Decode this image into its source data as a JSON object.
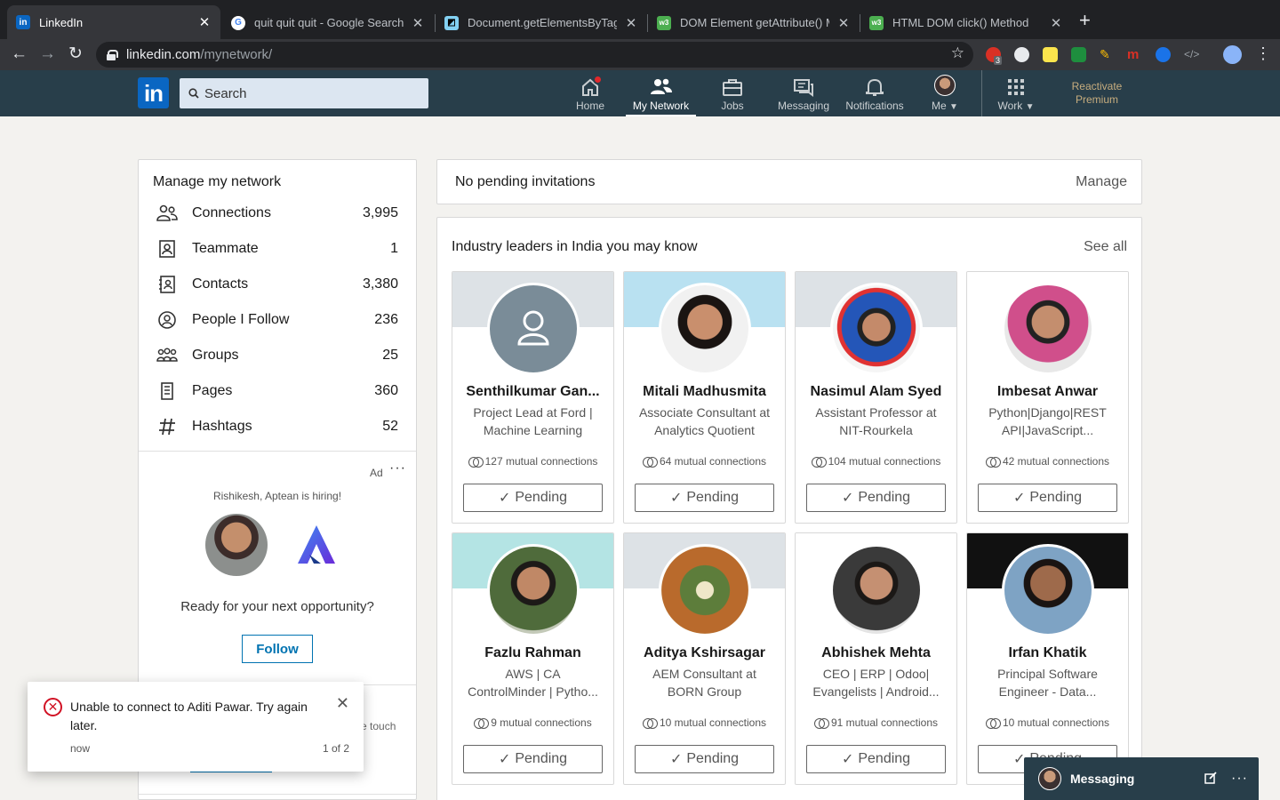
{
  "browser": {
    "tabs": [
      {
        "title": "LinkedIn",
        "favicon": "linkedin-icon",
        "active": true
      },
      {
        "title": "quit quit quit - Google Search",
        "favicon": "google-icon",
        "active": false
      },
      {
        "title": "Document.getElementsByTagN",
        "favicon": "mdn-icon",
        "active": false
      },
      {
        "title": "DOM Element getAttribute() M",
        "favicon": "w3schools-icon",
        "active": false
      },
      {
        "title": "HTML DOM click() Method",
        "favicon": "w3schools-icon",
        "active": false
      }
    ],
    "url_host": "linkedin.com",
    "url_path": "/mynetwork/",
    "extension_badge": "3"
  },
  "linkedin_nav": {
    "logo": "in",
    "search_placeholder": "Search",
    "items": [
      {
        "label": "Home",
        "icon": "home-icon"
      },
      {
        "label": "My Network",
        "icon": "network-icon"
      },
      {
        "label": "Jobs",
        "icon": "briefcase-icon"
      },
      {
        "label": "Messaging",
        "icon": "messaging-icon"
      },
      {
        "label": "Notifications",
        "icon": "bell-icon"
      },
      {
        "label": "Me",
        "icon": "avatar"
      },
      {
        "label": "Work",
        "icon": "grid-icon"
      }
    ],
    "premium_line1": "Reactivate",
    "premium_line2": "Premium"
  },
  "manage_network": {
    "title": "Manage my network",
    "rows": [
      {
        "label": "Connections",
        "count": "3,995",
        "icon": "connections-icon"
      },
      {
        "label": "Teammate",
        "count": "1",
        "icon": "teammate-icon"
      },
      {
        "label": "Contacts",
        "count": "3,380",
        "icon": "contacts-icon"
      },
      {
        "label": "People I Follow",
        "count": "236",
        "icon": "follow-icon"
      },
      {
        "label": "Groups",
        "count": "25",
        "icon": "groups-icon"
      },
      {
        "label": "Pages",
        "count": "360",
        "icon": "pages-icon"
      },
      {
        "label": "Hashtags",
        "count": "52",
        "icon": "hashtag-icon"
      }
    ]
  },
  "ad": {
    "label": "Ad",
    "more": "···",
    "hiring": "Rishikesh, Aptean is hiring!",
    "text": "Ready for your next opportunity?",
    "button": "Follow",
    "behind_text": "e touch"
  },
  "invitations": {
    "text": "No pending invitations",
    "manage": "Manage"
  },
  "pymk": {
    "title": "Industry leaders in India you may know",
    "see_all": "See all",
    "pending_label": "Pending",
    "people": [
      {
        "name": "Senthilkumar Gan...",
        "headline": "Project Lead at Ford | Machine Learning",
        "mutual": "127 mutual connections",
        "bg": "#dde2e6",
        "photo": "placeholder"
      },
      {
        "name": "Mitali Madhusmita",
        "headline": "Associate Consultant at Analytics Quotient",
        "mutual": "64 mutual connections",
        "bg": "#b9e1f1",
        "photo": "photo"
      },
      {
        "name": "Nasimul Alam Syed",
        "headline": "Assistant Professor at NIT-Rourkela",
        "mutual": "104 mutual connections",
        "bg": "#dde2e6",
        "photo": "photo"
      },
      {
        "name": "Imbesat Anwar",
        "headline": "Python|Django|REST API|JavaScript...",
        "mutual": "42 mutual connections",
        "bg": "#ffffff",
        "photo": "photo"
      },
      {
        "name": "Fazlu Rahman",
        "headline": "AWS | CA ControlMinder | Pytho...",
        "mutual": "9 mutual connections",
        "bg": "#b4e4e4",
        "photo": "photo"
      },
      {
        "name": "Aditya Kshirsagar",
        "headline": "AEM Consultant at BORN Group",
        "mutual": "10 mutual connections",
        "bg": "#dde2e6",
        "photo": "photo"
      },
      {
        "name": "Abhishek Mehta",
        "headline": "CEO | ERP | Odoo| Evangelists | Android...",
        "mutual": "91 mutual connections",
        "bg": "#ffffff",
        "photo": "photo"
      },
      {
        "name": "Irfan Khatik",
        "headline": "Principal Software Engineer - Data...",
        "mutual": "10 mutual connections",
        "bg": "#111111",
        "photo": "photo"
      }
    ]
  },
  "toast": {
    "message": "Unable to connect to Aditi Pawar. Try again later.",
    "time": "now",
    "page": "1 of 2"
  },
  "messaging": {
    "label": "Messaging"
  }
}
